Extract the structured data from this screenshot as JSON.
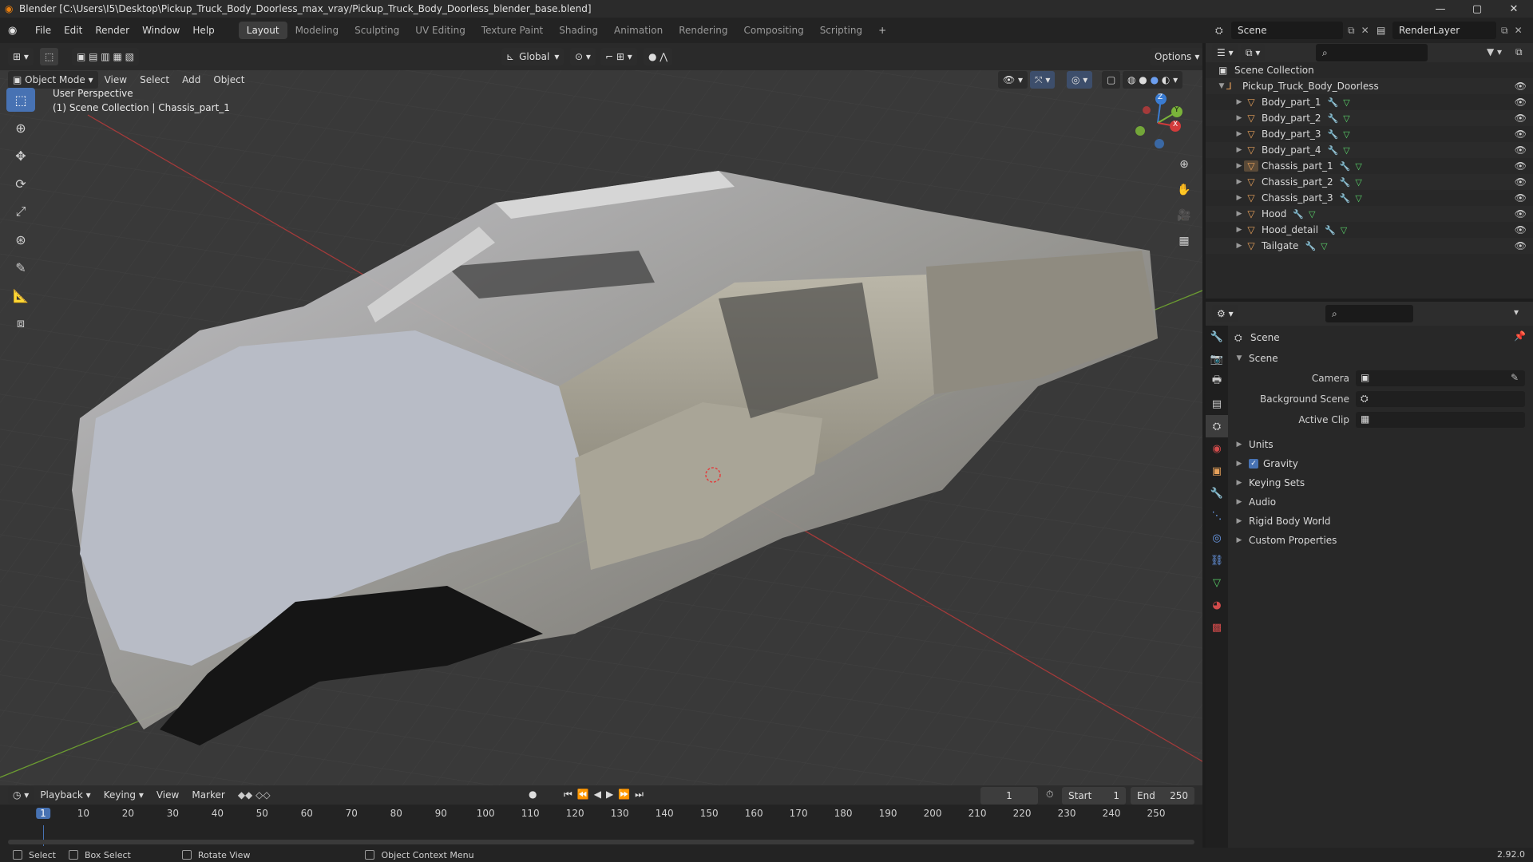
{
  "window": {
    "title": "Blender [C:\\Users\\I5\\Desktop\\Pickup_Truck_Body_Doorless_max_vray/Pickup_Truck_Body_Doorless_blender_base.blend]",
    "minimize": "—",
    "maximize": "▢",
    "close": "✕"
  },
  "menubar": {
    "items": [
      "File",
      "Edit",
      "Render",
      "Window",
      "Help"
    ]
  },
  "workspaces": {
    "tabs": [
      "Layout",
      "Modeling",
      "Sculpting",
      "UV Editing",
      "Texture Paint",
      "Shading",
      "Animation",
      "Rendering",
      "Compositing",
      "Scripting"
    ],
    "active": "Layout",
    "add": "+"
  },
  "scene_selector": {
    "value": "Scene"
  },
  "renderlayer_selector": {
    "value": "RenderLayer"
  },
  "viewport_header": {
    "mode": "Object Mode",
    "menus": [
      "View",
      "Select",
      "Add",
      "Object"
    ],
    "transform_orientation": "Global",
    "options": "Options"
  },
  "viewport": {
    "perspective_label": "User Perspective",
    "collection_label": "(1) Scene Collection | Chassis_part_1",
    "gizmo": {
      "x": "X",
      "y": "Y",
      "z": "Z"
    }
  },
  "outliner": {
    "root": "Scene Collection",
    "collection": "Pickup_Truck_Body_Doorless",
    "objects": [
      "Body_part_1",
      "Body_part_2",
      "Body_part_3",
      "Body_part_4",
      "Chassis_part_1",
      "Chassis_part_2",
      "Chassis_part_3",
      "Hood",
      "Hood_detail",
      "Tailgate"
    ],
    "selected": "Chassis_part_1"
  },
  "properties": {
    "context": "Scene",
    "panel": "Scene",
    "fields": [
      {
        "label": "Camera",
        "value": ""
      },
      {
        "label": "Background Scene",
        "value": ""
      },
      {
        "label": "Active Clip",
        "value": ""
      }
    ],
    "sections": [
      "Units",
      "Gravity",
      "Keying Sets",
      "Audio",
      "Rigid Body World",
      "Custom Properties"
    ],
    "gravity_checked": true
  },
  "timeline": {
    "menus": [
      "Playback",
      "Keying",
      "View",
      "Marker"
    ],
    "current_frame": "1",
    "start_label": "Start",
    "start": "1",
    "end_label": "End",
    "end": "250",
    "ticks": [
      "1",
      "10",
      "20",
      "30",
      "40",
      "50",
      "60",
      "70",
      "80",
      "90",
      "100",
      "110",
      "120",
      "130",
      "140",
      "150",
      "160",
      "170",
      "180",
      "190",
      "200",
      "210",
      "220",
      "230",
      "240",
      "250"
    ]
  },
  "statusbar": {
    "select": "Select",
    "box_select": "Box Select",
    "rotate_view": "Rotate View",
    "context_menu": "Object Context Menu",
    "version": "2.92.0"
  },
  "colors": {
    "accent": "#4772b3",
    "mesh_icon": "#e8a15a",
    "x_axis": "#d23b3b",
    "y_axis": "#7ab33a",
    "z_axis": "#3a7cd2"
  }
}
